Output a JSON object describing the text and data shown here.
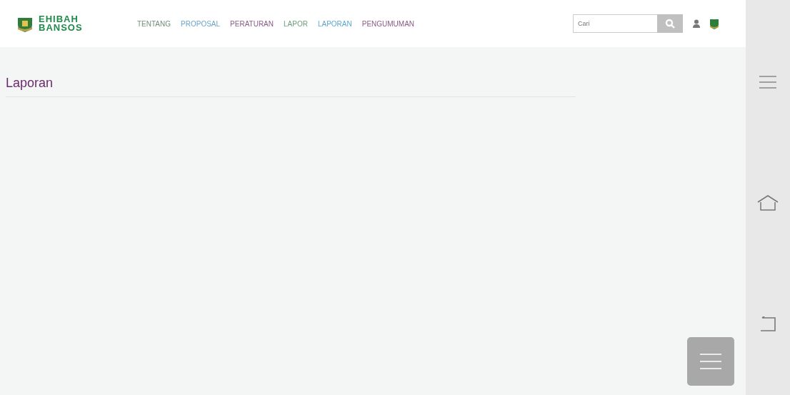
{
  "header": {
    "logo_lines": [
      "EHIBAH",
      "BANSOS"
    ],
    "nav": [
      {
        "label": "TENTANG",
        "color": "#6f8f7a"
      },
      {
        "label": "PROPOSAL",
        "color": "#6aa3c8"
      },
      {
        "label": "PERATURAN",
        "color": "#8a5a86"
      },
      {
        "label": "LAPOR",
        "color": "#6aa07a"
      },
      {
        "label": "LAPORAN",
        "color": "#5aa9cf"
      },
      {
        "label": "PENGUMUMAN",
        "color": "#8a5a86"
      }
    ],
    "search": {
      "placeholder": "Cari"
    }
  },
  "page": {
    "title": "Laporan"
  }
}
